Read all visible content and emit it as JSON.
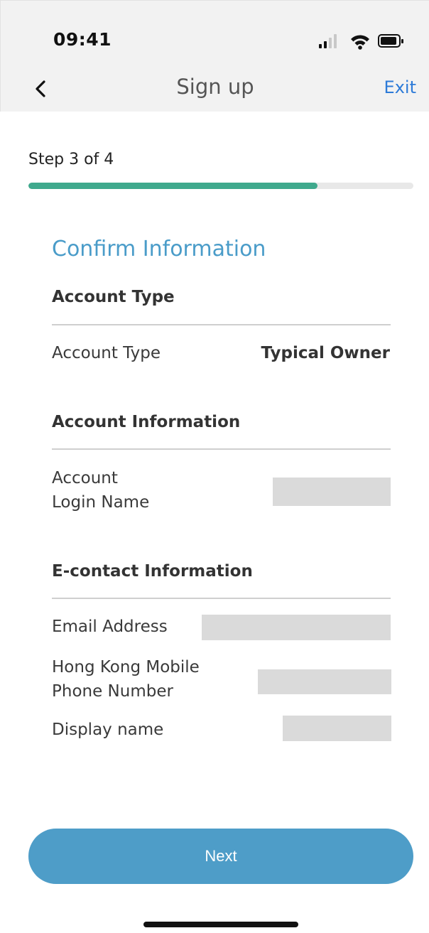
{
  "status_bar": {
    "time": "09:41",
    "icons": [
      "signal-icon",
      "wifi-icon",
      "battery-icon"
    ]
  },
  "nav": {
    "back_icon": "chevron-left-icon",
    "title": "Sign up",
    "exit_label": "Exit"
  },
  "progress": {
    "step_label": "Step 3 of 4",
    "fraction": 0.75,
    "color": "#3fa98d"
  },
  "card": {
    "title": "Confirm Information",
    "sections": {
      "account_type": {
        "heading": "Account Type",
        "field_label": "Account Type",
        "field_value": "Typical Owner"
      },
      "account_info": {
        "heading": "Account Information",
        "login_label_line1": "Account",
        "login_label_line2": "Login Name"
      },
      "econtact": {
        "heading": "E-contact Information",
        "email_label": "Email Address",
        "phone_label_line1": "Hong Kong Mobile",
        "phone_label_line2": "Phone Number",
        "display_name_label": "Display name"
      }
    }
  },
  "footer": {
    "next_label": "Next",
    "accent_color": "#4e9dc8"
  }
}
